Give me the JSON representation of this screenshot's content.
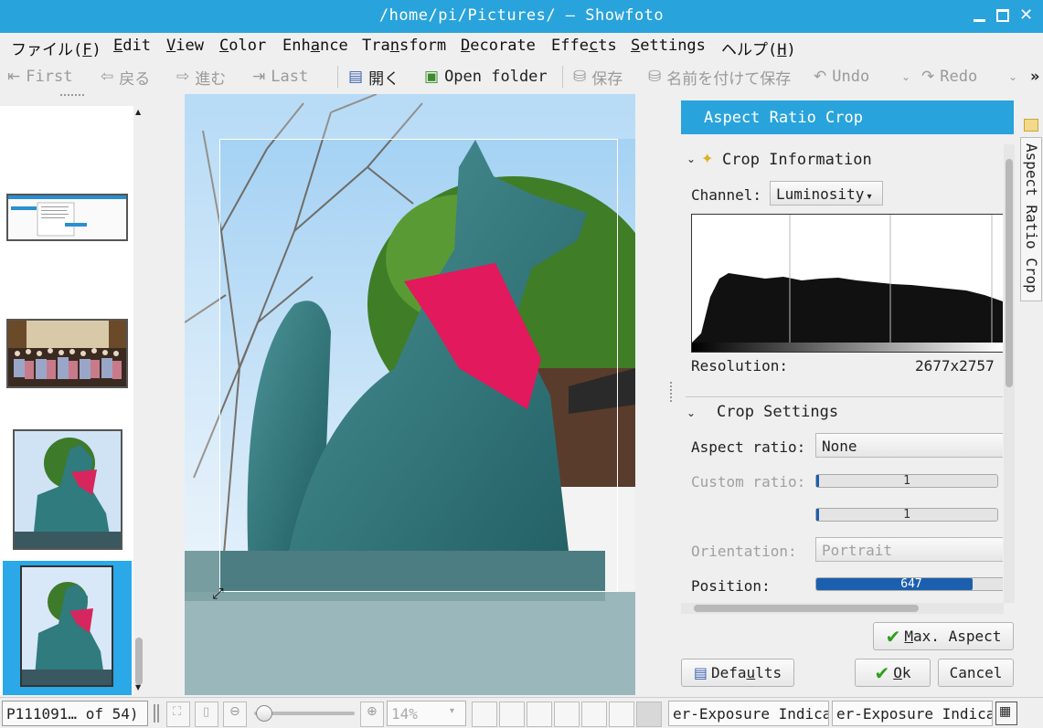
{
  "window": {
    "title": "/home/pi/Pictures/ — Showfoto"
  },
  "menu": [
    {
      "label": "ファイル(F)",
      "pre": "ファイル(",
      "u": "F",
      "post": ")"
    },
    {
      "label": "Edit",
      "pre": "",
      "u": "E",
      "post": "dit"
    },
    {
      "label": "View",
      "pre": "",
      "u": "V",
      "post": "iew"
    },
    {
      "label": "Color",
      "pre": "",
      "u": "C",
      "post": "olor"
    },
    {
      "label": "Enhance",
      "pre": "Enh",
      "u": "a",
      "post": "nce"
    },
    {
      "label": "Transform",
      "pre": "Tra",
      "u": "n",
      "post": "sform"
    },
    {
      "label": "Decorate",
      "pre": "",
      "u": "D",
      "post": "ecorate"
    },
    {
      "label": "Effects",
      "pre": "Effe",
      "u": "c",
      "post": "ts"
    },
    {
      "label": "Settings",
      "pre": "",
      "u": "S",
      "post": "ettings"
    },
    {
      "label": "ヘルプ(H)",
      "pre": "ヘルプ(",
      "u": "H",
      "post": ")"
    }
  ],
  "toolbar": {
    "first": "First",
    "back": "戻る",
    "forward": "進む",
    "last": "Last",
    "open": "開く",
    "open_folder": "Open folder",
    "save": "保存",
    "save_as": "名前を付けて保存",
    "undo": "Undo",
    "redo": "Redo",
    "more": "»"
  },
  "tool": {
    "title": "Aspect Ratio Crop",
    "crop_info": {
      "header": "Crop Information",
      "channel_label": "Channel:",
      "channel_value": "Luminosity",
      "resolution_label": "Resolution:",
      "resolution_value": "2677x2757"
    },
    "crop_settings": {
      "header": "Crop Settings",
      "aspect_label": "Aspect ratio:",
      "aspect_value": "None",
      "custom_label": "Custom ratio:",
      "custom_a": "1",
      "custom_b": "1",
      "orientation_label": "Orientation:",
      "orientation_value": "Portrait",
      "position_label": "Position:",
      "position_value": "647",
      "position_fraction": 0.82
    },
    "max_aspect": "Max. Aspect",
    "max_aspect_pre": "",
    "max_aspect_u": "M",
    "max_aspect_post": "ax. Aspect",
    "defaults": "Defaults",
    "defaults_pre": "Defa",
    "defaults_u": "u",
    "defaults_post": "lts",
    "ok": "Ok",
    "ok_pre": "",
    "ok_u": "O",
    "ok_post": "k",
    "cancel": "Cancel"
  },
  "side_tab": "Aspect Ratio Crop",
  "status": {
    "file": "P111091… of 54)",
    "zoom": "14%",
    "under_exposure": "er-Exposure Indica",
    "over_exposure": "er-Exposure Indica"
  },
  "colors": {
    "accent": "#29a3dc",
    "selection": "#2aa8e8",
    "position_bar": "#1c5fae"
  },
  "icons": [
    "first-icon",
    "back-icon",
    "forward-icon",
    "last-icon",
    "open-icon",
    "open-folder-icon",
    "save-icon",
    "save-as-icon",
    "undo-icon",
    "redo-icon",
    "folder-icon",
    "sparkle-icon",
    "check-icon",
    "defaults-icon",
    "zoom-fit-icon",
    "zoom-in-icon",
    "zoom-out-icon"
  ]
}
